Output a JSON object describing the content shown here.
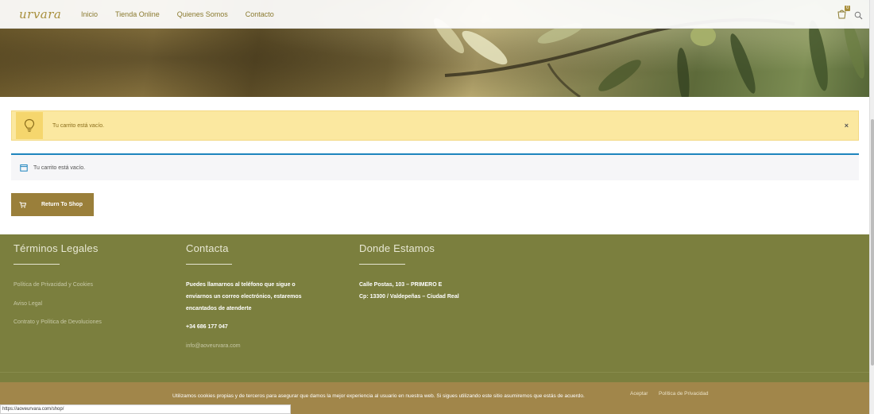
{
  "header": {
    "logo": "urvara",
    "nav": [
      {
        "label": "Inicio"
      },
      {
        "label": "Tienda Online"
      },
      {
        "label": "Quienes Somos"
      },
      {
        "label": "Contacto"
      }
    ],
    "cart_count": "0",
    "icons": [
      "cart-icon",
      "search-icon"
    ]
  },
  "notices": {
    "warning_text": "Tu carrito está vacío.",
    "warning_close": "×",
    "info_text": "Tu carrito está vacío."
  },
  "return_button": {
    "label": "Return To Shop"
  },
  "footer": {
    "legal": {
      "title": "Términos Legales",
      "links": [
        "Política de Privacidad y Cookies",
        "Aviso Legal",
        "Contrato y Política de Devoluciones"
      ]
    },
    "contact": {
      "title": "Contacta",
      "lines": [
        "Puedes llamarnos al teléfono que sigue o",
        "enviarnos un correo electrónico, estaremos",
        "encantados de atenderte"
      ],
      "phone": "+34 686 177 047",
      "email": "info@aoveurvara.com"
    },
    "location": {
      "title": "Donde Estamos",
      "lines": [
        "Calle Postas, 103 – PRIMERO E",
        "Cp: 13300 / Valdepeñas – Ciudad Real"
      ]
    }
  },
  "cookie_bar": {
    "text": "Utilizamos cookies propias y de terceros para asegurar que damos la mejor experiencia al usuario en nuestra web. Si sigues utilizando este sitio asumiremos que estás de acuerdo.",
    "accept": "Aceptar",
    "policy": "Política de Privacidad"
  },
  "status_url": "https://aoveurvara.com/shop/",
  "colors": {
    "brand_gold": "#a88f3c",
    "footer_green": "#7b7f3e",
    "notice_yellow": "#fbe8a0",
    "info_blue": "#1e85be"
  }
}
